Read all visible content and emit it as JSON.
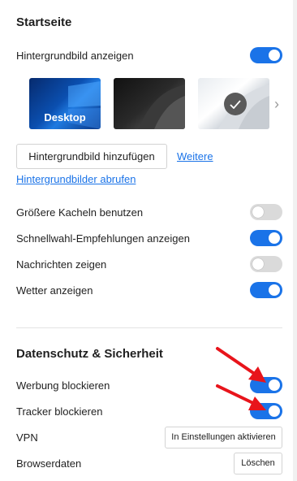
{
  "home": {
    "title": "Startseite",
    "show_bg_label": "Hintergrundbild anzeigen",
    "show_bg_on": true,
    "wallpapers": [
      {
        "label": "Desktop",
        "selected": false
      },
      {
        "label": "",
        "selected": false
      },
      {
        "label": "",
        "selected": true
      }
    ],
    "add_bg_label": "Hintergrundbild hinzufügen",
    "more_link": "Weitere",
    "fetch_link": "Hintergrundbilder abrufen",
    "settings": [
      {
        "label": "Größere Kacheln benutzen",
        "on": false
      },
      {
        "label": "Schnellwahl-Empfehlungen anzeigen",
        "on": true
      },
      {
        "label": "Nachrichten zeigen",
        "on": false
      },
      {
        "label": "Wetter anzeigen",
        "on": true
      }
    ]
  },
  "privacy": {
    "title": "Datenschutz & Sicherheit",
    "ad_block_label": "Werbung blockieren",
    "ad_block_on": true,
    "tracker_label": "Tracker blockieren",
    "tracker_on": true,
    "vpn_label": "VPN",
    "vpn_button": "In Einstellungen aktivieren",
    "browser_data_label": "Browserdaten",
    "clear_button": "Löschen"
  },
  "colors": {
    "accent": "#1a73e8",
    "arrow": "#e8141b",
    "toggle_off": "#dadada"
  }
}
